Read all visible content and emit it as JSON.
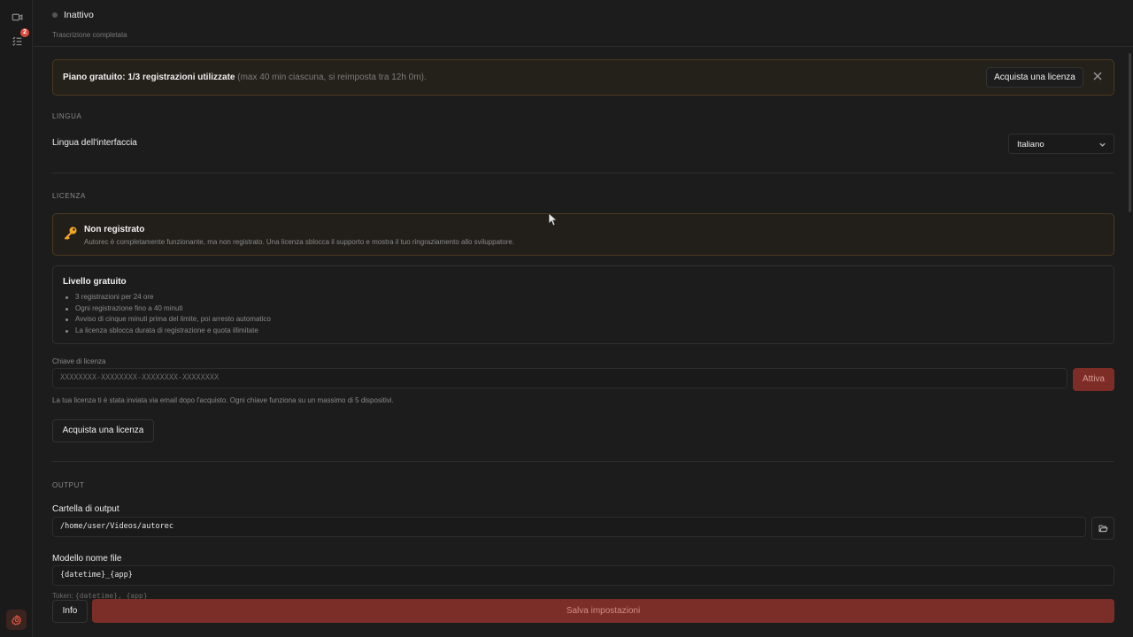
{
  "rail": {
    "badge_count": "2"
  },
  "header": {
    "status": "Inattivo",
    "substatus": "Trascrizione completata"
  },
  "banner": {
    "bold": "Piano gratuito: 1/3 registrazioni utilizzate",
    "muted": "(max 40 min ciascuna, si reimposta tra 12h 0m).",
    "button": "Acquista una licenza"
  },
  "language": {
    "section": "LINGUA",
    "label": "Lingua dell'interfaccia",
    "selected": "Italiano"
  },
  "license": {
    "section": "LICENZA",
    "warn_title": "Non registrato",
    "warn_desc": "Autorec è completamente funzionante, ma non registrato. Una licenza sblocca il supporto e mostra il tuo ringraziamento allo sviluppatore.",
    "tier_title": "Livello gratuito",
    "tier_items": [
      "3 registrazioni per 24 ore",
      "Ogni registrazione fino a 40 minuti",
      "Avviso di cinque minuti prima del limite, poi arresto automatico",
      "La licenza sblocca durata di registrazione e quota illimitate"
    ],
    "key_label": "Chiave di licenza",
    "key_placeholder": "XXXXXXXX-XXXXXXXX-XXXXXXXX-XXXXXXXX",
    "activate": "Attiva",
    "hint": "La tua licenza ti è stata inviata via email dopo l'acquisto. Ogni chiave funziona su un massimo di 5 dispositivi.",
    "buy": "Acquista una licenza"
  },
  "output": {
    "section": "OUTPUT",
    "folder_label": "Cartella di output",
    "folder_value": "/home/user/Videos/autorec",
    "pattern_label": "Modello nome file",
    "pattern_value": "{datetime}_{app}",
    "token_prefix": "Token:",
    "token_values": "{datetime}, {app}"
  },
  "footer": {
    "info": "Info",
    "save": "Salva impostazioni"
  },
  "colors": {
    "accent": "#7b2e27",
    "warning_border": "#4a3a1e",
    "key_icon": "#f5a524"
  }
}
